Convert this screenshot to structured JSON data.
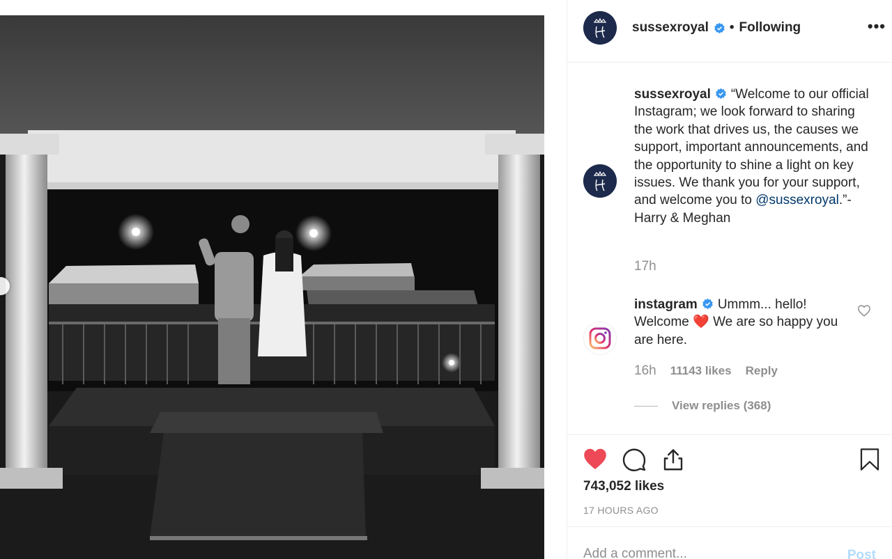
{
  "post": {
    "image_alt": "Couple waving from a balcony at night",
    "carousel_indicator": "previous"
  },
  "header": {
    "username": "sussexroyal",
    "separator": "•",
    "follow_status": "Following",
    "more_label": "•••"
  },
  "caption": {
    "username": "sussexroyal",
    "text_before": "“Welcome to our official Instagram; we look forward to sharing the work that drives us, the causes we support, important announcements, and the opportunity to shine a light on key issues. We thank you for your support, and welcome you to ",
    "mention": "@sussexroyal",
    "text_after": ".”- Harry & Meghan",
    "time": "17h"
  },
  "comment": {
    "username": "instagram",
    "text_before": "Ummm... hello! Welcome ",
    "emoji": "❤️",
    "text_after": " We are so happy you are here.",
    "time": "16h",
    "likes": "11143 likes",
    "reply_label": "Reply",
    "view_replies": "View replies (368)"
  },
  "actions": {
    "likes": "743,052 likes",
    "timestamp": "17 HOURS AGO"
  },
  "add_comment": {
    "placeholder": "Add a comment...",
    "post_label": "Post"
  },
  "colors": {
    "like_red": "#ed4956",
    "verified_blue": "#3897f0",
    "mention_blue": "#00376b",
    "muted": "#8e8e8e",
    "post_disabled": "#b3dbff"
  },
  "icons": {
    "verified": "verified-badge-icon",
    "like": "heart-filled-icon",
    "comment": "comment-bubble-icon",
    "share": "share-icon",
    "save": "bookmark-icon",
    "comment_like": "heart-outline-icon",
    "more": "more-dots-icon"
  }
}
